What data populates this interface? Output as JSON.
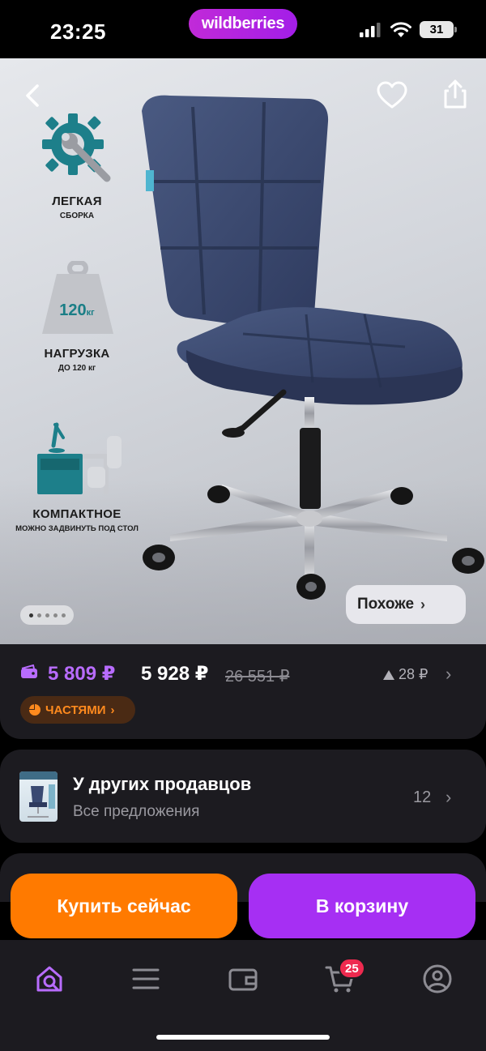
{
  "status_bar": {
    "time": "23:25",
    "brand": "wildberries",
    "battery": "31",
    "icons": [
      "signal-icon",
      "wifi-icon",
      "battery-icon"
    ]
  },
  "hero": {
    "features": [
      {
        "title": "ЛЕГКАЯ",
        "subtitle": "СБОРКА",
        "icon": "wrench-gear-icon"
      },
      {
        "title": "НАГРУЗКА",
        "subtitle": "ДО 120 кг",
        "icon": "weight-icon",
        "badge_value": "120",
        "badge_unit": "кг"
      },
      {
        "title": "КОМПАКТНОЕ",
        "subtitle": "МОЖНО ЗАДВИНУТЬ ПОД СТОЛ",
        "icon": "desk-icon"
      }
    ],
    "similar_label": "Похоже",
    "carousel": {
      "count": 5,
      "active": 1
    }
  },
  "price": {
    "wallet_price": "5 809 ₽",
    "price": "5 928 ₽",
    "old_price": "26 551 ₽",
    "change": "28 ₽",
    "installments_label": "ЧАСТЯМИ"
  },
  "sellers": {
    "title": "У других продавцов",
    "subtitle": "Все предложения",
    "count": "12"
  },
  "actions": {
    "buy_now": "Купить сейчас",
    "add_to_cart": "В корзину"
  },
  "tabbar": {
    "cart_badge": "25",
    "tabs": [
      "home-search-icon",
      "menu-icon",
      "wallet-icon",
      "cart-icon",
      "profile-icon"
    ]
  },
  "colors": {
    "brand": "#a62ff3",
    "accent_orange": "#ff7a00",
    "wallet_price": "#b86cff",
    "badge_red": "#ee2a4f",
    "card_bg": "#1c1b20"
  }
}
